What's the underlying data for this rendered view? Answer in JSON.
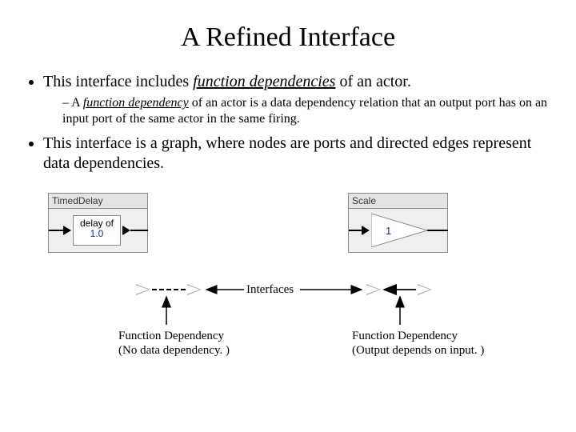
{
  "title": "A Refined Interface",
  "bullets": {
    "b1_pre": "This interface includes ",
    "b1_em": "function dependencies",
    "b1_post": " of an actor.",
    "b1s_pre": "A ",
    "b1s_em": "function dependency",
    "b1s_post": " of an actor is a data dependency relation that an output port has on an input port of the same actor in the same firing.",
    "b2": "This interface is a graph, where nodes are ports and directed edges represent data dependencies."
  },
  "diagram": {
    "left_box": {
      "title": "TimedDelay",
      "label": "delay of",
      "value": "1.0"
    },
    "right_box": {
      "title": "Scale",
      "value": "1"
    },
    "interfaces_label": "Interfaces",
    "left_caption_l1": "Function Dependency",
    "left_caption_l2": "(No data dependency. )",
    "right_caption_l1": "Function Dependency",
    "right_caption_l2": "(Output depends on input. )"
  }
}
